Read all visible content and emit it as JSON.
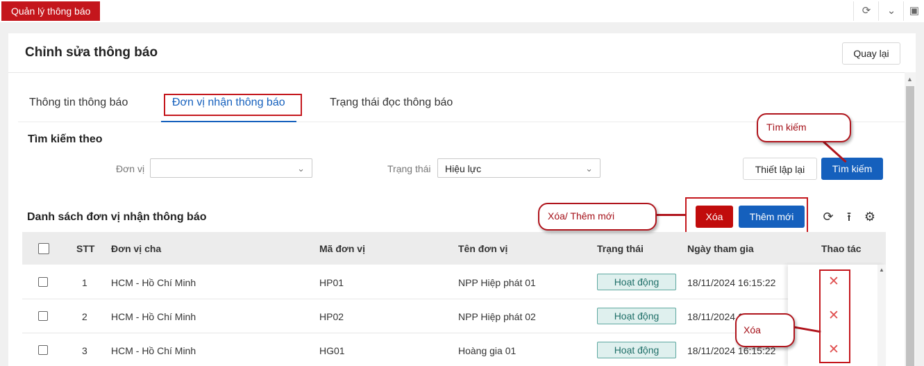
{
  "app_tab": "Quản lý thông báo",
  "top_icons": [
    "refresh-icon",
    "chevron-down-icon",
    "fullscreen-icon"
  ],
  "page": {
    "title": "Chỉnh sửa thông báo",
    "back_label": "Quay lại"
  },
  "tabs": [
    {
      "label": "Thông tin thông báo",
      "active": false
    },
    {
      "label": "Đơn vị nhận thông báo",
      "active": true
    },
    {
      "label": "Trạng thái đọc thông báo",
      "active": false
    }
  ],
  "search": {
    "title": "Tìm kiếm theo",
    "unit_label": "Đơn vị",
    "unit_value": "",
    "status_label": "Trạng thái",
    "status_value": "Hiệu lực",
    "reset_label": "Thiết lập lại",
    "search_label": "Tìm kiếm"
  },
  "list": {
    "title": "Danh sách đơn vị nhận thông báo",
    "delete_label": "Xóa",
    "add_label": "Thêm mới",
    "tools": [
      "refresh-icon",
      "column-height-icon",
      "settings-icon"
    ],
    "columns": [
      "STT",
      "Đơn vị cha",
      "Mã đơn vị",
      "Tên đơn vị",
      "Trạng thái",
      "Ngày tham gia",
      "Thao tác"
    ],
    "rows": [
      {
        "stt": "1",
        "parent": "HCM - Hồ Chí Minh",
        "code": "HP01",
        "name": "NPP Hiệp phát 01",
        "status": "Hoạt động",
        "joined": "18/11/2024 16:15:22"
      },
      {
        "stt": "2",
        "parent": "HCM - Hồ Chí Minh",
        "code": "HP02",
        "name": "NPP Hiệp phát 02",
        "status": "Hoạt động",
        "joined": "18/11/2024 16:15:22"
      },
      {
        "stt": "3",
        "parent": "HCM - Hồ Chí Minh",
        "code": "HG01",
        "name": "Hoàng gia 01",
        "status": "Hoạt động",
        "joined": "18/11/2024 16:15:22"
      }
    ]
  },
  "callouts": {
    "search": "Tìm kiếm",
    "delete_add": "Xóa/ Thêm mới",
    "delete": "Xóa"
  },
  "colors": {
    "brand_red": "#c4161c",
    "primary_blue": "#1560bd",
    "status_green": "#dff0ee",
    "delete_icon": "#e05050"
  }
}
